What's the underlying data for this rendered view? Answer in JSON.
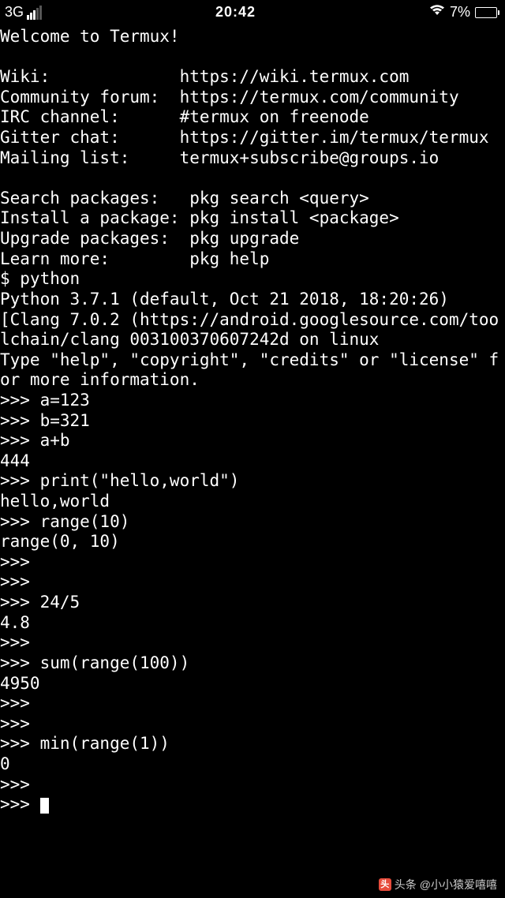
{
  "status_bar": {
    "network_type": "3G",
    "time": "20:42",
    "battery_percent": "7%"
  },
  "terminal": {
    "lines": [
      "Welcome to Termux!",
      "",
      "Wiki:             https://wiki.termux.com",
      "Community forum:  https://termux.com/community",
      "IRC channel:      #termux on freenode",
      "Gitter chat:      https://gitter.im/termux/termux",
      "Mailing list:     termux+subscribe@groups.io",
      "",
      "Search packages:   pkg search <query>",
      "Install a package: pkg install <package>",
      "Upgrade packages:  pkg upgrade",
      "Learn more:        pkg help",
      "$ python",
      "Python 3.7.1 (default, Oct 21 2018, 18:20:26)",
      "[Clang 7.0.2 (https://android.googlesource.com/toolchain/clang 003100370607242d on linux",
      "Type \"help\", \"copyright\", \"credits\" or \"license\" for more information.",
      ">>> a=123",
      ">>> b=321",
      ">>> a+b",
      "444",
      ">>> print(\"hello,world\")",
      "hello,world",
      ">>> range(10)",
      "range(0, 10)",
      ">>>",
      ">>>",
      ">>> 24/5",
      "4.8",
      ">>>",
      ">>> sum(range(100))",
      "4950",
      ">>>",
      ">>>",
      ">>> min(range(1))",
      "0",
      ">>>",
      ">>> "
    ]
  },
  "watermark": {
    "prefix": "头条",
    "handle": "@小小猿爱嘻嘻"
  }
}
